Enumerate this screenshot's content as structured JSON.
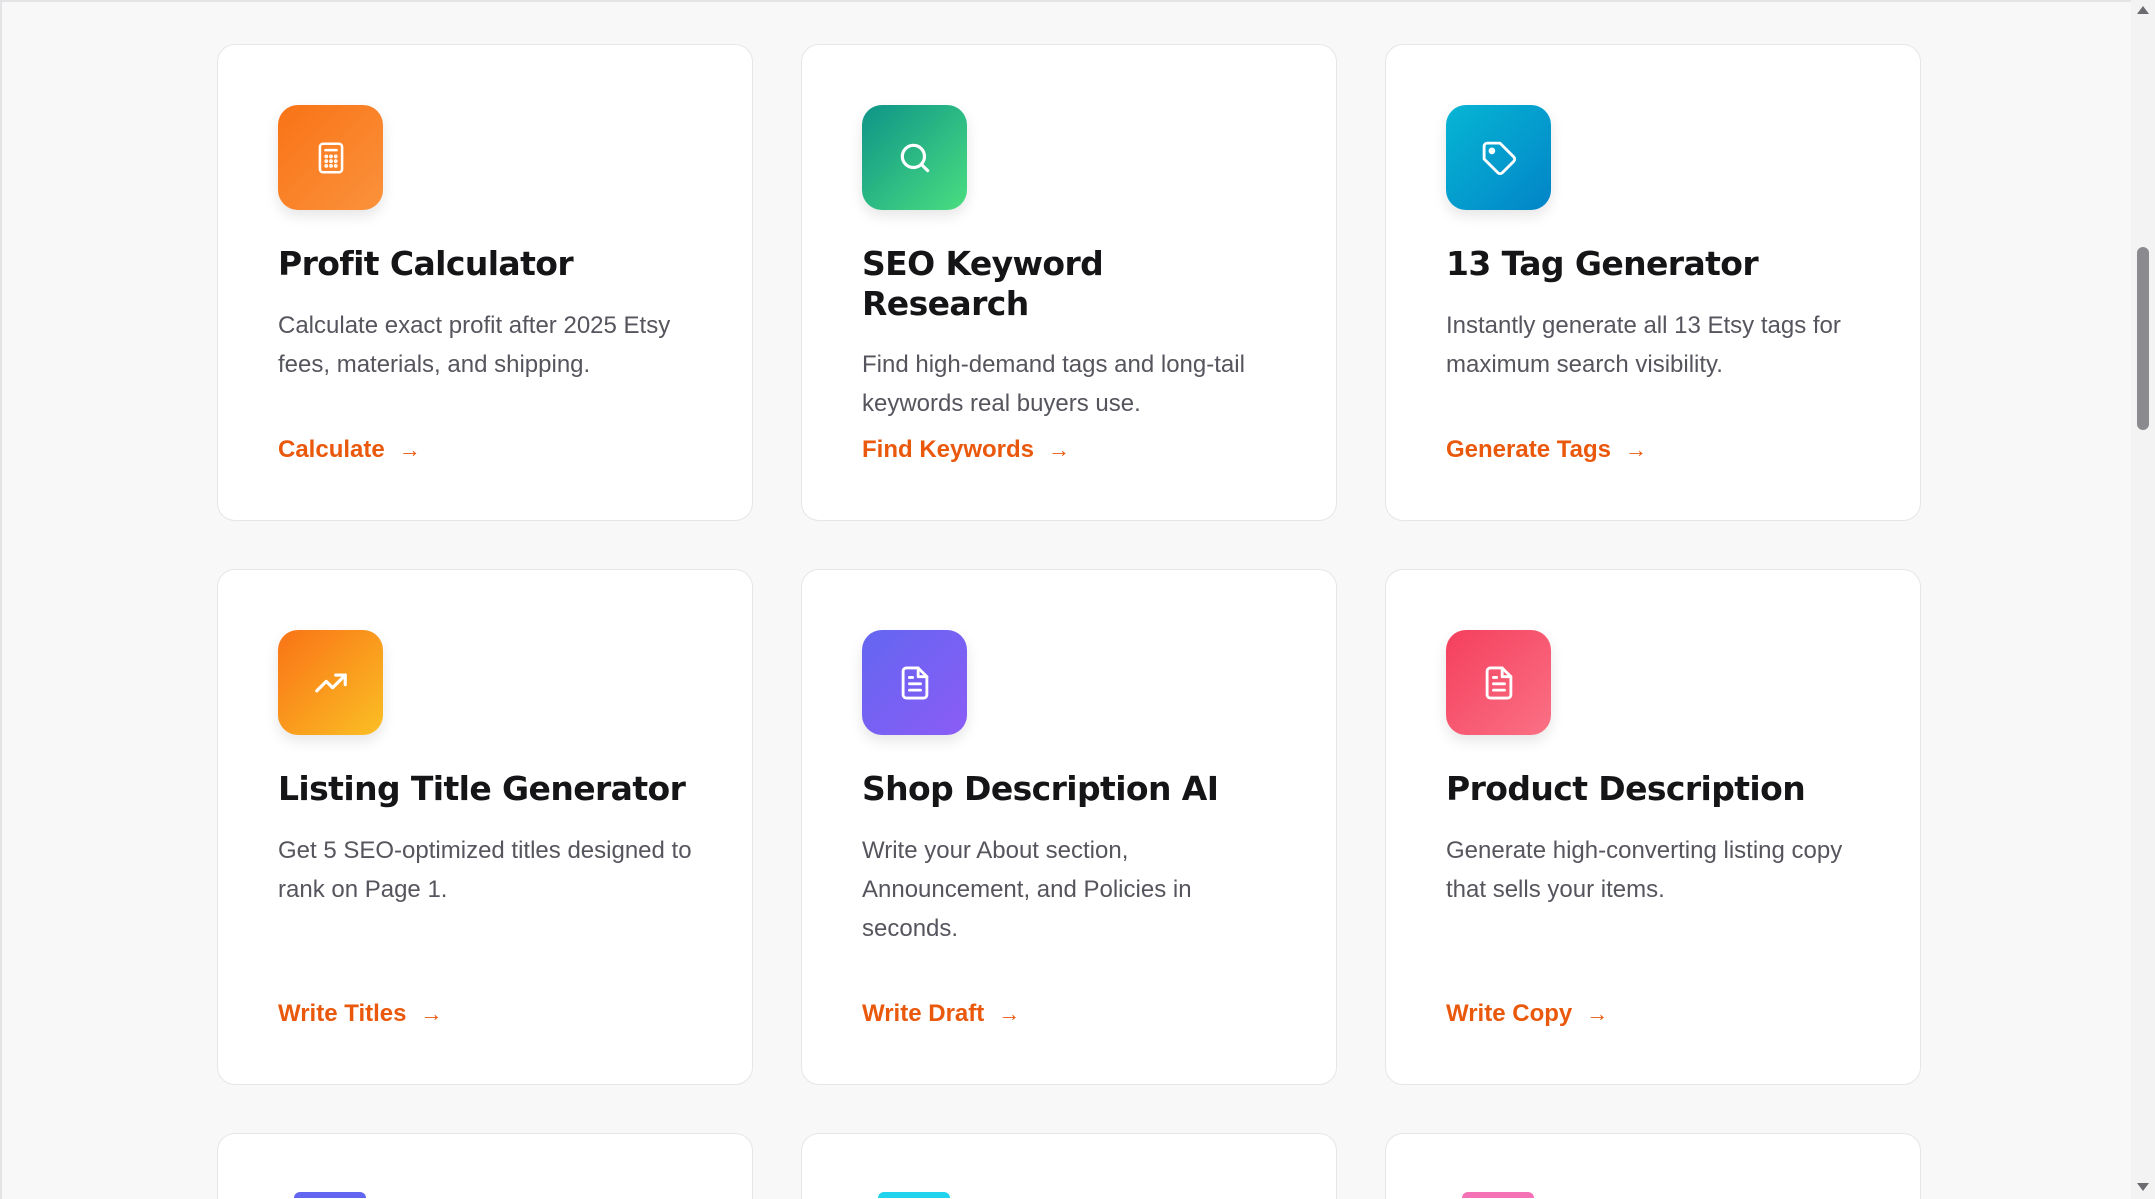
{
  "tools": [
    {
      "title": "Profit Calculator",
      "description": "Calculate exact profit after 2025 Etsy fees, materials, and shipping.",
      "cta": "Calculate",
      "icon": "calculator-icon",
      "gradient": [
        "#f97316",
        "#fb923c"
      ]
    },
    {
      "title": "SEO Keyword Research",
      "description": "Find high-demand tags and long-tail keywords real buyers use.",
      "cta": "Find Keywords",
      "icon": "search-icon",
      "gradient": [
        "#0d9488",
        "#4ade80"
      ]
    },
    {
      "title": "13 Tag Generator",
      "description": "Instantly generate all 13 Etsy tags for maximum search visibility.",
      "cta": "Generate Tags",
      "icon": "tag-icon",
      "gradient": [
        "#06b6d4",
        "#0284c7"
      ]
    },
    {
      "title": "Listing Title Generator",
      "description": "Get 5 SEO-optimized titles designed to rank on Page 1.",
      "cta": "Write Titles",
      "icon": "trending-up-icon",
      "gradient": [
        "#f97316",
        "#fbbf24"
      ]
    },
    {
      "title": "Shop Description AI",
      "description": "Write your About section, Announcement, and Policies in seconds.",
      "cta": "Write Draft",
      "icon": "document-icon",
      "gradient": [
        "#6366f1",
        "#8b5cf6"
      ]
    },
    {
      "title": "Product Description",
      "description": "Generate high-converting listing copy that sells your items.",
      "cta": "Write Copy",
      "icon": "document-icon",
      "gradient": [
        "#f43f5e",
        "#fb7185"
      ]
    }
  ],
  "partial_cards": [
    {
      "icon_color": "#6366f1"
    },
    {
      "icon_color": "#22d3ee"
    },
    {
      "icon_color": "#f472b6"
    }
  ],
  "cta_arrow": "→",
  "colors": {
    "accent": "#ea580c",
    "title": "#151517",
    "text": "#55555d"
  }
}
